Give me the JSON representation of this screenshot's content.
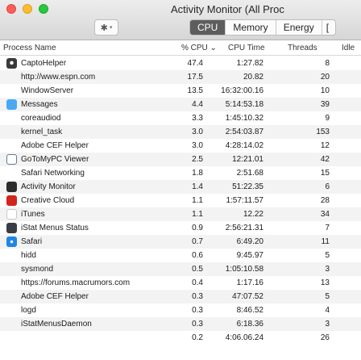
{
  "window": {
    "title": "Activity Monitor (All Proc"
  },
  "toolbar": {
    "gear_glyph": "✱",
    "chev_glyph": "▾",
    "tabs": [
      {
        "label": "CPU",
        "active": true
      },
      {
        "label": "Memory",
        "active": false
      },
      {
        "label": "Energy",
        "active": false
      },
      {
        "label": "[",
        "active": false
      }
    ]
  },
  "columns": {
    "process_name": "Process Name",
    "cpu": "% CPU ⌄",
    "cpu_time": "CPU Time",
    "threads": "Threads",
    "idle": "Idle"
  },
  "processes": [
    {
      "name": "CaptoHelper",
      "cpu": "47.4",
      "time": "1:27.82",
      "threads": "8",
      "icon": "capto-icon"
    },
    {
      "name": "http://www.espn.com",
      "cpu": "17.5",
      "time": "20.82",
      "threads": "20",
      "icon": ""
    },
    {
      "name": "WindowServer",
      "cpu": "13.5",
      "time": "16:32:00.16",
      "threads": "10",
      "icon": ""
    },
    {
      "name": "Messages",
      "cpu": "4.4",
      "time": "5:14:53.18",
      "threads": "39",
      "icon": "messages-icon"
    },
    {
      "name": "coreaudiod",
      "cpu": "3.3",
      "time": "1:45:10.32",
      "threads": "9",
      "icon": ""
    },
    {
      "name": "kernel_task",
      "cpu": "3.0",
      "time": "2:54:03.87",
      "threads": "153",
      "icon": ""
    },
    {
      "name": "Adobe CEF Helper",
      "cpu": "3.0",
      "time": "4:28:14.02",
      "threads": "12",
      "icon": ""
    },
    {
      "name": "GoToMyPC Viewer",
      "cpu": "2.5",
      "time": "12:21.01",
      "threads": "42",
      "icon": "gotomypc-icon"
    },
    {
      "name": "Safari Networking",
      "cpu": "1.8",
      "time": "2:51.68",
      "threads": "15",
      "icon": ""
    },
    {
      "name": "Activity Monitor",
      "cpu": "1.4",
      "time": "51:22.35",
      "threads": "6",
      "icon": "activity-monitor-icon"
    },
    {
      "name": "Creative Cloud",
      "cpu": "1.1",
      "time": "1:57:11.57",
      "threads": "28",
      "icon": "creative-cloud-icon"
    },
    {
      "name": "iTunes",
      "cpu": "1.1",
      "time": "12.22",
      "threads": "34",
      "icon": "itunes-icon"
    },
    {
      "name": "iStat Menus Status",
      "cpu": "0.9",
      "time": "2:56:21.31",
      "threads": "7",
      "icon": "istat-icon"
    },
    {
      "name": "Safari",
      "cpu": "0.7",
      "time": "6:49.20",
      "threads": "11",
      "icon": "safari-icon"
    },
    {
      "name": "hidd",
      "cpu": "0.6",
      "time": "9:45.97",
      "threads": "5",
      "icon": ""
    },
    {
      "name": "sysmond",
      "cpu": "0.5",
      "time": "1:05:10.58",
      "threads": "3",
      "icon": ""
    },
    {
      "name": "https://forums.macrumors.com",
      "cpu": "0.4",
      "time": "1:17.16",
      "threads": "13",
      "icon": ""
    },
    {
      "name": "Adobe CEF Helper",
      "cpu": "0.3",
      "time": "47:07.52",
      "threads": "5",
      "icon": ""
    },
    {
      "name": "logd",
      "cpu": "0.3",
      "time": "8:46.52",
      "threads": "4",
      "icon": ""
    },
    {
      "name": "iStatMenusDaemon",
      "cpu": "0.3",
      "time": "6:18.36",
      "threads": "3",
      "icon": ""
    },
    {
      "name": "",
      "cpu": "0.2",
      "time": "4:06.06.24",
      "threads": "26",
      "icon": ""
    }
  ]
}
